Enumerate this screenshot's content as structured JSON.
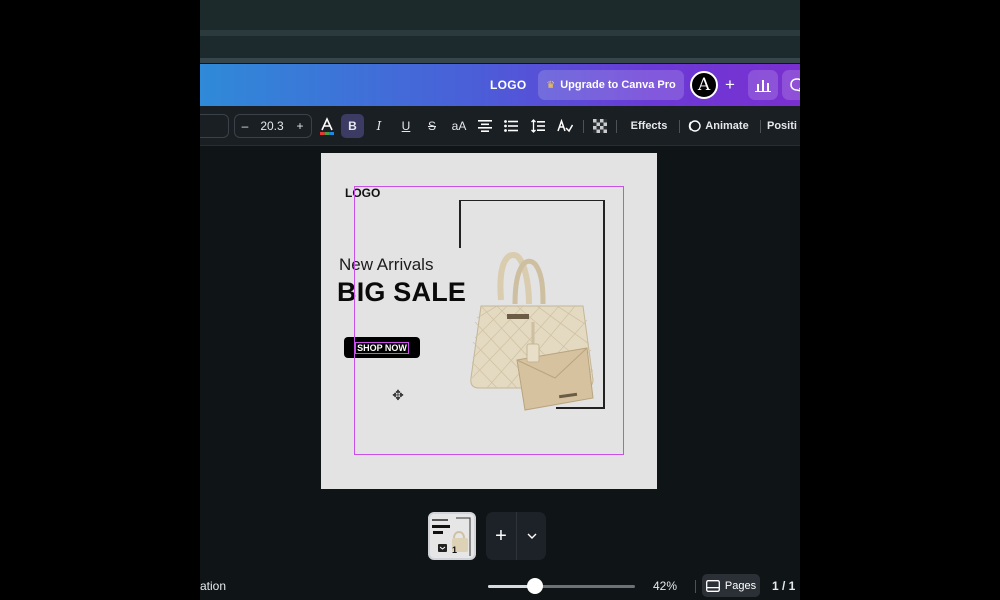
{
  "header": {
    "logo_text": "LOGO",
    "upgrade_label": "Upgrade to Canva Pro",
    "avatar_letter": "A",
    "add_label": "+"
  },
  "toolbar": {
    "font_size": "20.3",
    "minus": "–",
    "plus": "+",
    "bold": "B",
    "italic": "I",
    "underline": "U",
    "strike": "S",
    "case": "aA",
    "effects_label": "Effects",
    "animate_label": "Animate",
    "position_label": "Positi"
  },
  "canvas": {
    "logo": "LOGO",
    "subtitle": "New Arrivals",
    "title": "BIG SALE",
    "button": "SHOP NOW"
  },
  "pages_strip": {
    "page_number": "1",
    "add_page": "+"
  },
  "footer": {
    "left_text": "ation",
    "zoom": "42%",
    "zoom_fraction": 0.32,
    "pages_label": "Pages",
    "page_count": "1 / 1"
  },
  "colors": {
    "accent": "#c850e6",
    "header_start": "#2f8ad8",
    "header_end": "#7a2fd0"
  }
}
